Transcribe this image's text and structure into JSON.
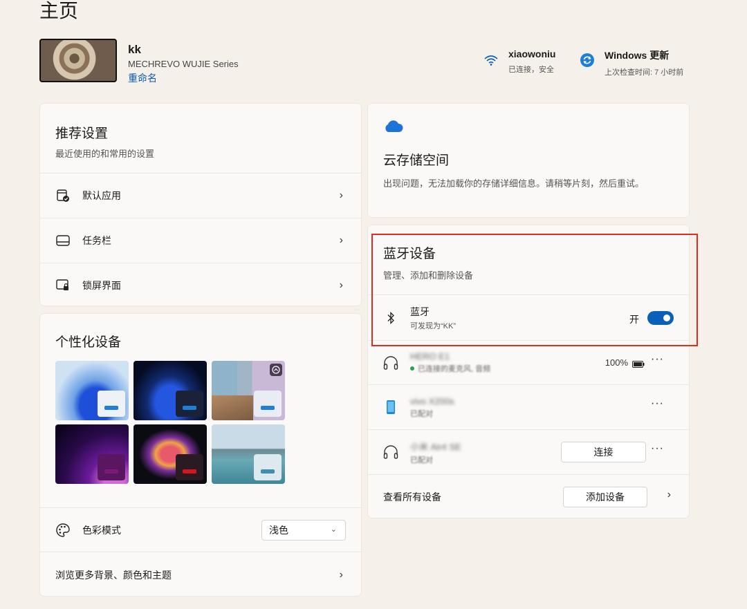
{
  "page": {
    "title": "主页"
  },
  "device": {
    "name": "kk",
    "model": "MECHREVO WUJIE Series",
    "rename_label": "重命名"
  },
  "wifi": {
    "name": "xiaowoniu",
    "status": "已连接，安全"
  },
  "update": {
    "title": "Windows 更新",
    "status": "上次检查时间: 7 小时前"
  },
  "recommended": {
    "title": "推荐设置",
    "subtitle": "最近使用的和常用的设置",
    "items": [
      {
        "label": "默认应用",
        "icon": "default-apps-icon"
      },
      {
        "label": "任务栏",
        "icon": "taskbar-icon"
      },
      {
        "label": "锁屏界面",
        "icon": "lock-screen-icon"
      }
    ]
  },
  "personalize": {
    "title": "个性化设备",
    "color_mode_label": "色彩模式",
    "color_mode_value": "浅色",
    "browse_label": "浏览更多背景、颜色和主题"
  },
  "cloud": {
    "title": "云存储空间",
    "message": "出现问题，无法加载你的存储详细信息。请稍等片刻，然后重试。"
  },
  "bluetooth": {
    "title": "蓝牙设备",
    "subtitle": "管理、添加和删除设备",
    "toggle_label": "蓝牙",
    "discoverable": "可发现为“KK”",
    "toggle_state": "开",
    "devices": [
      {
        "name": "HERO E1",
        "status": "已连接的麦克风, 音频",
        "battery": "100%",
        "icon": "headphones-icon"
      },
      {
        "name": "vivo X200s",
        "status": "已配对",
        "icon": "phone-icon"
      },
      {
        "name": "小米 Air4 SE",
        "status": "已配对",
        "icon": "headphones-icon",
        "action": "连接"
      }
    ],
    "view_all_label": "查看所有设备",
    "add_device_label": "添加设备"
  },
  "colors": {
    "accent": "#0a5fb8",
    "highlight": "#e02b20",
    "background": "#f6f0eb"
  }
}
